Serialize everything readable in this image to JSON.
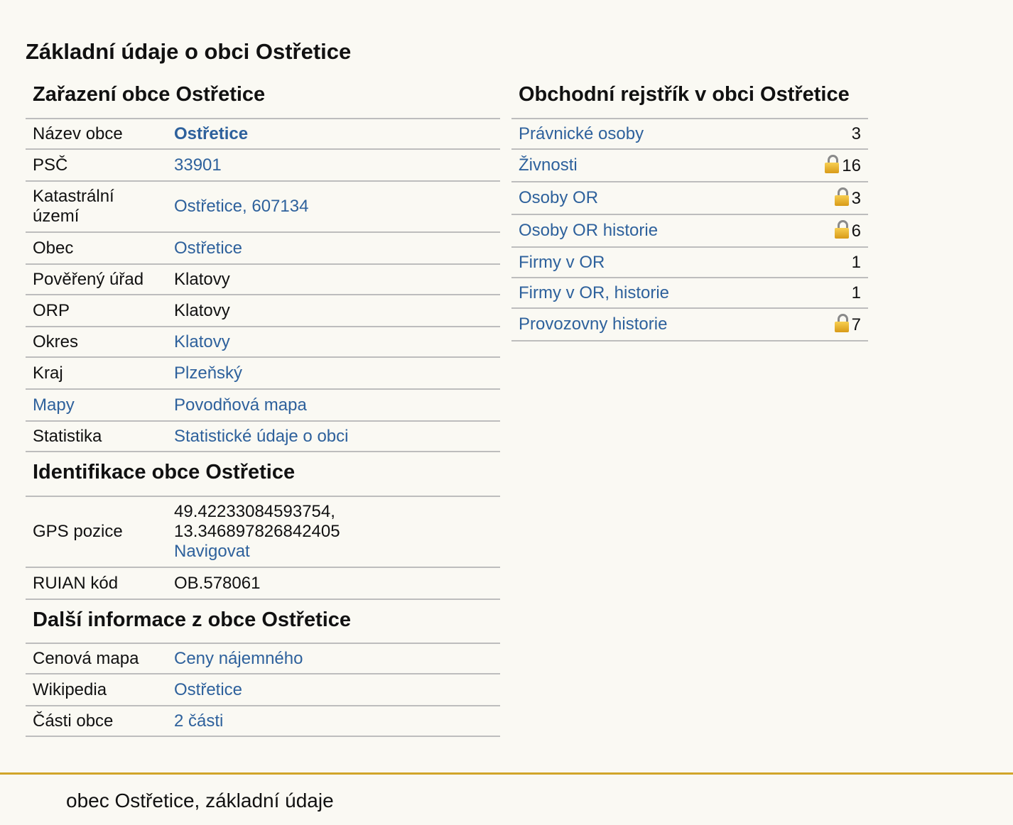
{
  "page_title": "Základní údaje o obci Ostřetice",
  "zarazeni": {
    "title": "Zařazení obce Ostřetice",
    "rows": [
      {
        "key": "Název obce",
        "value": "Ostřetice"
      },
      {
        "key": "PSČ",
        "value": "33901"
      },
      {
        "key": "Katastrální území",
        "value": "Ostřetice, 607134"
      },
      {
        "key": "Obec",
        "value": "Ostřetice"
      },
      {
        "key": "Pověřený úřad",
        "value": "Klatovy"
      },
      {
        "key": "ORP",
        "value": "Klatovy"
      },
      {
        "key": "Okres",
        "value": "Klatovy"
      },
      {
        "key": "Kraj",
        "value": "Plzeňský"
      },
      {
        "key": "Mapy",
        "value": "Povodňová mapa"
      },
      {
        "key": "Statistika",
        "value": "Statistické údaje o obci"
      }
    ]
  },
  "identifikace": {
    "title": "Identifikace obce Ostřetice",
    "gps_label": "GPS pozice",
    "gps_lat": "49.42233084593754,",
    "gps_lon": "13.346897826842405",
    "navigate_label": "Navigovat",
    "ruian_label": "RUIAN kód",
    "ruian_value": "OB.578061"
  },
  "dalsi": {
    "title": "Další informace z obce Ostřetice",
    "rows": [
      {
        "key": "Cenová mapa",
        "value": "Ceny nájemného"
      },
      {
        "key": "Wikipedia",
        "value": "Ostřetice"
      },
      {
        "key": "Části obce",
        "value": "2 části"
      }
    ]
  },
  "rejstrik": {
    "title": "Obchodní rejstřík v obci Ostřetice",
    "rows": [
      {
        "label": "Právnické osoby",
        "count": "3",
        "locked": false
      },
      {
        "label": "Živnosti",
        "count": "16",
        "locked": true
      },
      {
        "label": "Osoby OR",
        "count": "3",
        "locked": true
      },
      {
        "label": "Osoby OR historie",
        "count": "6",
        "locked": true
      },
      {
        "label": "Firmy v OR",
        "count": "1",
        "locked": false
      },
      {
        "label": "Firmy v OR, historie",
        "count": "1",
        "locked": false
      },
      {
        "label": "Provozovny historie",
        "count": "7",
        "locked": true
      }
    ]
  },
  "footer_text": "obec Ostřetice, základní údaje",
  "colors": {
    "link": "#2e619c",
    "footer_line": "#d1a52a",
    "background": "#faf9f3",
    "lock": "#f0c040"
  }
}
